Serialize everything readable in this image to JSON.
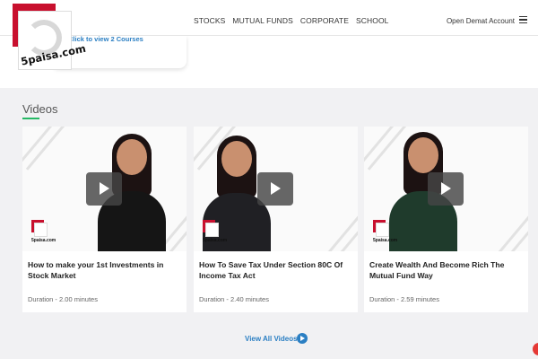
{
  "header": {
    "nav": [
      "STOCKS",
      "MUTUAL FUNDS",
      "CORPORATE",
      "SCHOOL"
    ],
    "cta": "Open Demat Account"
  },
  "logo": {
    "text": "5paisa.com"
  },
  "course": {
    "link": "Click to view 2 Courses"
  },
  "videos": {
    "section_title": "Videos",
    "items": [
      {
        "title": "How to make your 1st Investments in Stock Market",
        "duration": "Duration - 2.00 minutes"
      },
      {
        "title": "How To Save Tax Under Section 80C Of Income Tax Act",
        "duration": "Duration - 2.40 minutes"
      },
      {
        "title": "Create Wealth And Become Rich The Mutual Fund Way",
        "duration": "Duration - 2.59 minutes"
      }
    ],
    "view_all": "View All Videos"
  },
  "colors": {
    "accent_green": "#25b864",
    "link_blue": "#2b7fc3",
    "brand_red": "#c8102e"
  }
}
